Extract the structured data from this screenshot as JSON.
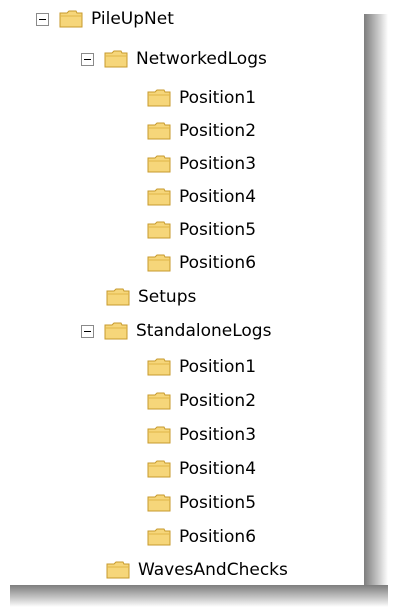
{
  "tree": {
    "root": {
      "label": "PileUpNet",
      "icon": "folder-icon",
      "expanded": true
    },
    "networked_logs": {
      "label": "NetworkedLogs",
      "icon": "folder-icon",
      "expanded": true,
      "children": [
        "Position1",
        "Position2",
        "Position3",
        "Position4",
        "Position5",
        "Position6"
      ]
    },
    "setups": {
      "label": "Setups",
      "icon": "folder-icon"
    },
    "standalone_logs": {
      "label": "StandaloneLogs",
      "icon": "folder-icon",
      "expanded": true,
      "children": [
        "Position1",
        "Position2",
        "Position3",
        "Position4",
        "Position5",
        "Position6"
      ]
    },
    "waves_and_checks": {
      "label": "WavesAndChecks",
      "icon": "folder-icon"
    }
  },
  "colors": {
    "folder_fill": "#f6d67a",
    "folder_stroke": "#c79a2c",
    "expander_border": "#8a8a8a",
    "shadow": "#7d7d7d"
  }
}
